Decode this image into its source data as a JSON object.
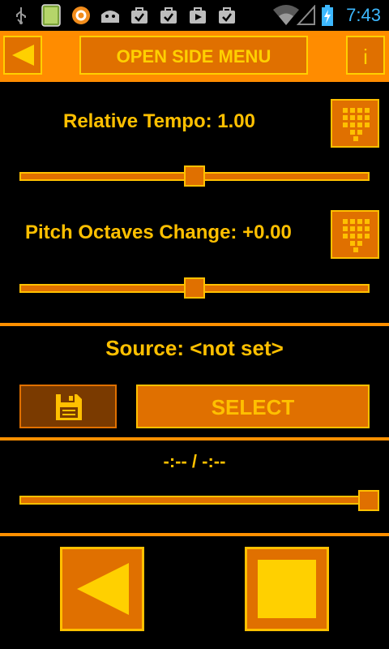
{
  "status_bar": {
    "time": "7:43"
  },
  "action_bar": {
    "title_button": "OPEN SIDE MENU",
    "info_button": "i"
  },
  "tempo": {
    "label": "Relative Tempo: 1.00",
    "slider_value": 0.5
  },
  "pitch": {
    "label": "Pitch Octaves Change: +0.00",
    "slider_value": 0.5
  },
  "source": {
    "label": "Source: <not set>",
    "select_button": "SELECT"
  },
  "playback": {
    "time_label": "-:-- / -:--",
    "position_value": 1.0
  },
  "colors": {
    "accent": "#ff8c00",
    "button_fill": "#e07000",
    "text": "#ffc000",
    "background": "#000000"
  },
  "icons": [
    "back-arrow-icon",
    "keypad-icon",
    "save-icon",
    "rewind-icon",
    "stop-icon"
  ]
}
